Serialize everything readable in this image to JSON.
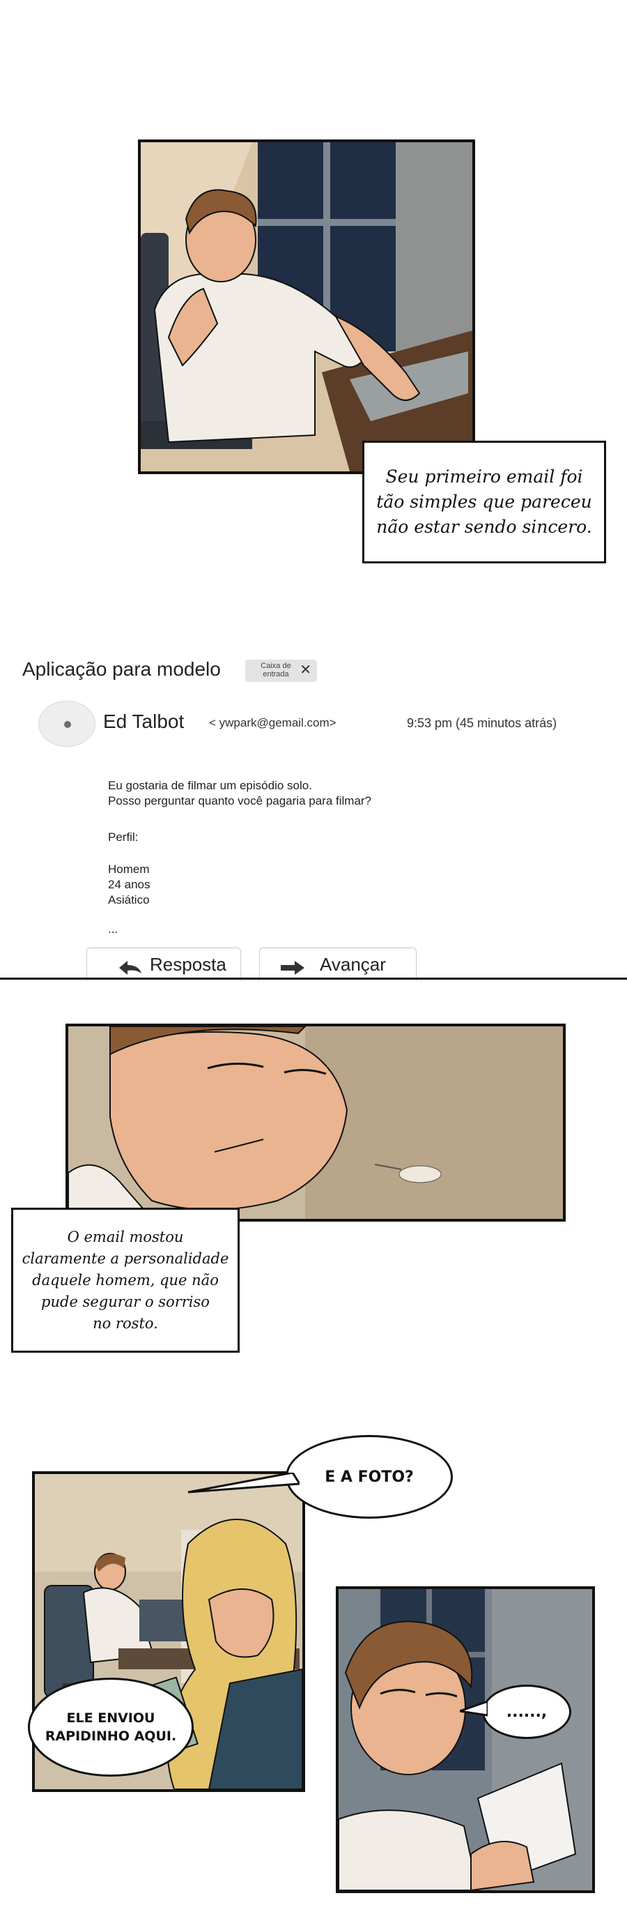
{
  "panel1": {
    "caption": "Seu primeiro email foi\ntão simples que pareceu\nnão estar sendo sincero."
  },
  "email": {
    "subject": "Aplicação para modelo",
    "folder_tag": "Caixa de\nentrada",
    "close_symbol": "✕",
    "sender_name": "Ed Talbot",
    "sender_address": "< ywpark@gemail.com>",
    "time": "9:53 pm (45 minutos atrás)",
    "body": {
      "line1": "Eu gostaria de filmar um episódio solo.",
      "line2": "Posso perguntar quanto você pagaria para filmar?",
      "line3": "Perfil:",
      "line4": "Homem",
      "line5": "24 anos",
      "line6": "Asiático",
      "line7": "..."
    },
    "reply_label": "Resposta",
    "forward_label": "Avançar"
  },
  "panel2": {
    "caption": "O email mostou\nclaramente a personalidade\ndaquele homem, que não\npude segurar o sorriso\nno rosto."
  },
  "panel3": {
    "bubble_top": "E A FOTO?",
    "bubble_left": "ELE ENVIOU\nRAPIDINHO AQUI."
  },
  "panel4": {
    "bubble": "......,"
  },
  "colors": {
    "ink": "#111111",
    "skin": "#e9b48f",
    "hair": "#8a5a34",
    "shirt": "#f1ede6",
    "wall": "#c9b9a0",
    "window": "#26344a",
    "blonde": "#e5c46c",
    "navy": "#2f4a5c"
  }
}
